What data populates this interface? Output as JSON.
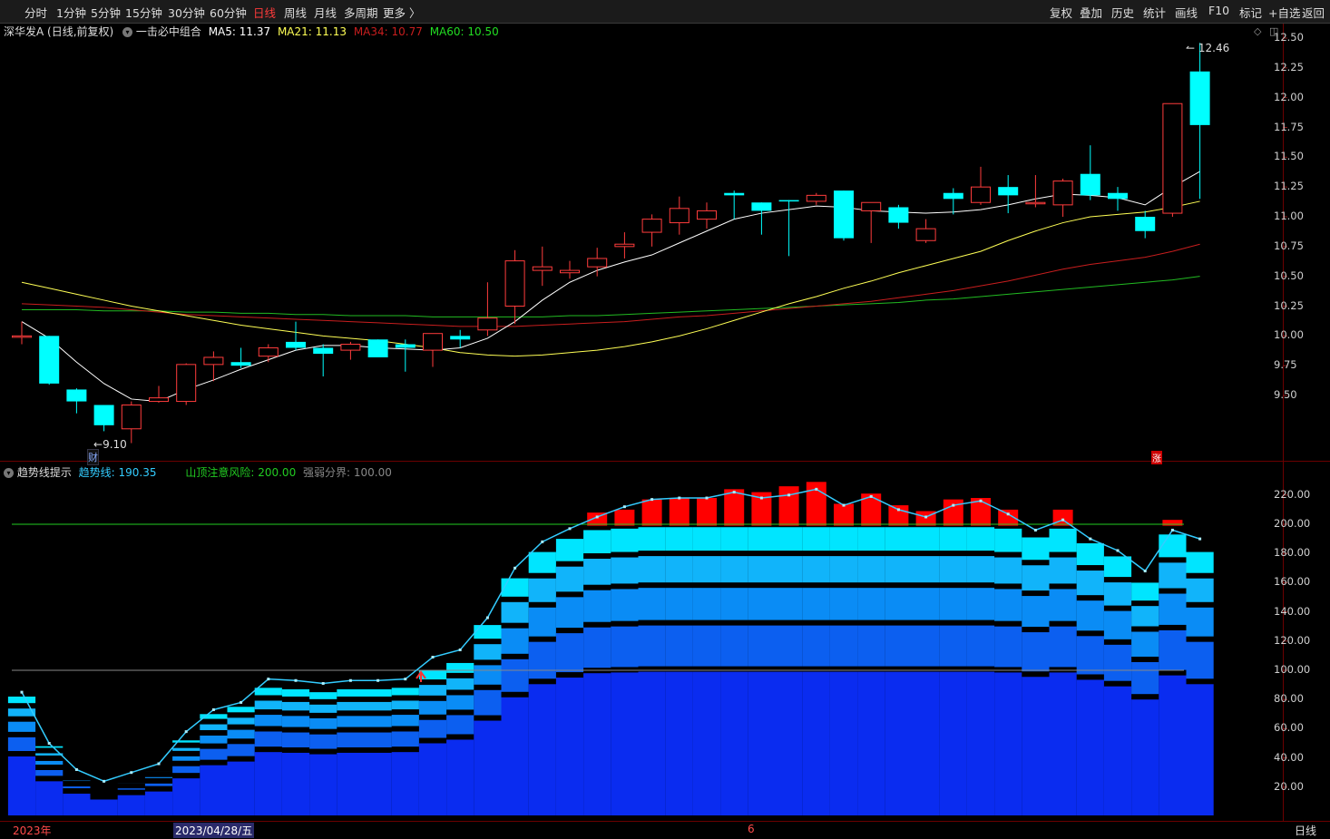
{
  "toolbar": {
    "periods": [
      "分时",
      "1分钟",
      "5分钟",
      "15分钟",
      "30分钟",
      "60分钟",
      "日线",
      "周线",
      "月线",
      "多周期",
      "更多 〉"
    ],
    "active_period": "日线",
    "actions": [
      "复权",
      "叠加",
      "历史",
      "统计",
      "画线",
      "F10",
      "标记",
      "+自选",
      "返回"
    ]
  },
  "main_legend": {
    "stock": "深华发A (日线,前复权)",
    "indicator": "一击必中组合",
    "ma5": "MA5: 11.37",
    "ma21": "MA21: 11.13",
    "ma34": "MA34: 10.77",
    "ma60": "MA60: 10.50"
  },
  "sub_legend": {
    "title": "趋势线提示",
    "trend": "趋势线: 190.35",
    "risk": "山顶注意风险: 200.00",
    "boundary": "强弱分界: 100.00"
  },
  "annotations": {
    "high": "12.46",
    "low": "9.10",
    "cai": "财",
    "zhang": "涨"
  },
  "bottom_axis": {
    "year": "2023年",
    "cursor_date": "2023/04/28/五",
    "month": "6",
    "period": "日线"
  },
  "colors": {
    "up": "#ff3c3c",
    "down": "#00ffff",
    "ma5": "#ffffff",
    "ma21": "#ffff55",
    "ma34": "#c81e1e",
    "ma60": "#22bb22",
    "trend": "#33ccff"
  },
  "chart_data": [
    {
      "type": "candlestick",
      "title": "深华发A (日线,前复权)",
      "ylim": [
        9.2,
        12.6
      ],
      "yticks": [
        9.5,
        9.75,
        10.0,
        10.25,
        10.5,
        10.75,
        11.0,
        11.25,
        11.5,
        11.75,
        12.0,
        12.25,
        12.5
      ],
      "ohlc": [
        [
          10.0,
          10.12,
          9.93,
          10.0
        ],
        [
          10.0,
          10.0,
          9.59,
          9.6
        ],
        [
          9.55,
          9.56,
          9.35,
          9.45
        ],
        [
          9.42,
          9.42,
          9.2,
          9.25
        ],
        [
          9.22,
          9.45,
          9.1,
          9.42
        ],
        [
          9.45,
          9.58,
          9.44,
          9.48
        ],
        [
          9.45,
          9.77,
          9.42,
          9.76
        ],
        [
          9.76,
          9.87,
          9.62,
          9.82
        ],
        [
          9.78,
          9.9,
          9.73,
          9.75
        ],
        [
          9.83,
          9.93,
          9.78,
          9.9
        ],
        [
          9.95,
          10.12,
          9.88,
          9.9
        ],
        [
          9.9,
          9.93,
          9.66,
          9.85
        ],
        [
          9.88,
          9.95,
          9.8,
          9.93
        ],
        [
          9.97,
          9.97,
          9.85,
          9.82
        ],
        [
          9.93,
          9.97,
          9.7,
          9.9
        ],
        [
          9.88,
          10.02,
          9.74,
          10.02
        ],
        [
          10.0,
          10.05,
          9.9,
          9.97
        ],
        [
          10.05,
          10.45,
          10.0,
          10.15
        ],
        [
          10.25,
          10.72,
          10.1,
          10.63
        ],
        [
          10.55,
          10.75,
          10.42,
          10.58
        ],
        [
          10.53,
          10.63,
          10.48,
          10.55
        ],
        [
          10.58,
          10.74,
          10.5,
          10.65
        ],
        [
          10.75,
          10.87,
          10.65,
          10.77
        ],
        [
          10.87,
          11.02,
          10.75,
          10.98
        ],
        [
          10.95,
          11.17,
          10.85,
          11.07
        ],
        [
          10.98,
          11.12,
          10.9,
          11.05
        ],
        [
          11.2,
          11.22,
          10.98,
          11.18
        ],
        [
          11.12,
          11.12,
          10.85,
          11.05
        ],
        [
          11.14,
          11.14,
          10.67,
          11.13
        ],
        [
          11.13,
          11.2,
          11.1,
          11.18
        ],
        [
          11.22,
          11.22,
          10.8,
          10.82
        ],
        [
          11.05,
          11.12,
          10.78,
          11.12
        ],
        [
          11.08,
          11.1,
          10.9,
          10.95
        ],
        [
          10.8,
          10.98,
          10.78,
          10.9
        ],
        [
          11.2,
          11.24,
          11.02,
          11.15
        ],
        [
          11.12,
          11.42,
          11.1,
          11.25
        ],
        [
          11.25,
          11.35,
          11.03,
          11.18
        ],
        [
          11.12,
          11.35,
          11.08,
          11.12
        ],
        [
          11.1,
          11.32,
          11.0,
          11.3
        ],
        [
          11.36,
          11.6,
          11.14,
          11.18
        ],
        [
          11.2,
          11.25,
          11.05,
          11.15
        ],
        [
          11.0,
          11.05,
          10.82,
          10.88
        ],
        [
          11.03,
          11.95,
          11.0,
          11.95
        ],
        [
          12.22,
          12.46,
          11.15,
          11.77
        ]
      ],
      "ma5": [
        10.12,
        9.98,
        9.78,
        9.6,
        9.47,
        9.45,
        9.55,
        9.63,
        9.72,
        9.8,
        9.88,
        9.92,
        9.92,
        9.9,
        9.89,
        9.88,
        9.9,
        9.98,
        10.12,
        10.3,
        10.45,
        10.55,
        10.62,
        10.68,
        10.78,
        10.88,
        10.98,
        11.03,
        11.06,
        11.09,
        11.08,
        11.05,
        11.04,
        11.03,
        11.04,
        11.06,
        11.1,
        11.15,
        11.19,
        11.18,
        11.16,
        11.1,
        11.25,
        11.38
      ],
      "ma21": [
        10.45,
        10.4,
        10.35,
        10.3,
        10.25,
        10.21,
        10.17,
        10.13,
        10.09,
        10.06,
        10.03,
        10.0,
        9.98,
        9.96,
        9.93,
        9.9,
        9.86,
        9.84,
        9.83,
        9.84,
        9.86,
        9.88,
        9.91,
        9.95,
        10.0,
        10.06,
        10.13,
        10.2,
        10.27,
        10.33,
        10.4,
        10.46,
        10.53,
        10.59,
        10.65,
        10.71,
        10.8,
        10.88,
        10.95,
        11.0,
        11.02,
        11.04,
        11.08,
        11.13
      ],
      "ma34": [
        10.27,
        10.26,
        10.25,
        10.24,
        10.22,
        10.2,
        10.18,
        10.17,
        10.16,
        10.15,
        10.14,
        10.13,
        10.12,
        10.11,
        10.1,
        10.09,
        10.08,
        10.08,
        10.08,
        10.09,
        10.1,
        10.11,
        10.12,
        10.14,
        10.16,
        10.17,
        10.19,
        10.21,
        10.23,
        10.25,
        10.27,
        10.29,
        10.32,
        10.35,
        10.38,
        10.42,
        10.46,
        10.51,
        10.56,
        10.6,
        10.63,
        10.66,
        10.71,
        10.77
      ],
      "ma60": [
        10.22,
        10.22,
        10.22,
        10.21,
        10.21,
        10.21,
        10.2,
        10.2,
        10.19,
        10.19,
        10.18,
        10.18,
        10.17,
        10.17,
        10.17,
        10.16,
        10.16,
        10.16,
        10.16,
        10.16,
        10.17,
        10.17,
        10.18,
        10.19,
        10.2,
        10.21,
        10.22,
        10.23,
        10.24,
        10.25,
        10.26,
        10.27,
        10.28,
        10.3,
        10.31,
        10.33,
        10.35,
        10.37,
        10.39,
        10.41,
        10.43,
        10.45,
        10.47,
        10.5
      ]
    },
    {
      "type": "bar",
      "title": "趋势线提示",
      "ylim": [
        0,
        230
      ],
      "yticks": [
        20,
        40,
        60,
        80,
        100,
        120,
        140,
        160,
        180,
        200,
        220
      ],
      "reference_lines": [
        100,
        200
      ],
      "trend": [
        85,
        50,
        32,
        24,
        30,
        36,
        58,
        73,
        78,
        94,
        93,
        91,
        93,
        93,
        94,
        109,
        114,
        136,
        170,
        188,
        197,
        205,
        212,
        217,
        218,
        218,
        222,
        218,
        220,
        224,
        213,
        219,
        210,
        205,
        213,
        216,
        207,
        196,
        203,
        190,
        182,
        168,
        196,
        190
      ],
      "red_bars": [
        [
          0,
          0
        ],
        [
          0,
          0
        ],
        [
          0,
          0
        ],
        [
          0,
          0
        ],
        [
          0,
          0
        ],
        [
          0,
          0
        ],
        [
          0,
          0
        ],
        [
          0,
          0
        ],
        [
          0,
          0
        ],
        [
          0,
          0
        ],
        [
          0,
          0
        ],
        [
          0,
          0
        ],
        [
          0,
          0
        ],
        [
          0,
          0
        ],
        [
          0,
          0
        ],
        [
          0,
          0
        ],
        [
          0,
          0
        ],
        [
          0,
          0
        ],
        [
          0,
          0
        ],
        [
          0,
          0
        ],
        [
          0,
          0
        ],
        [
          199,
          208
        ],
        [
          199,
          210
        ],
        [
          199,
          217
        ],
        [
          199,
          218
        ],
        [
          199,
          218
        ],
        [
          199,
          224
        ],
        [
          199,
          222
        ],
        [
          199,
          226
        ],
        [
          199,
          229
        ],
        [
          199,
          214
        ],
        [
          199,
          221
        ],
        [
          199,
          213
        ],
        [
          199,
          209
        ],
        [
          199,
          217
        ],
        [
          199,
          218
        ],
        [
          199,
          210
        ],
        [
          0,
          0
        ],
        [
          199,
          210
        ],
        [
          0,
          0
        ],
        [
          0,
          0
        ],
        [
          0,
          0
        ],
        [
          199,
          203
        ],
        [
          0,
          0
        ]
      ],
      "layer_top": [
        82,
        48,
        31,
        23,
        29,
        34,
        52,
        70,
        75,
        88,
        87,
        85,
        87,
        87,
        88,
        100,
        105,
        131,
        163,
        181,
        190,
        196,
        197,
        198,
        198,
        198,
        198,
        198,
        198,
        198,
        198,
        198,
        198,
        198,
        198,
        198,
        197,
        191,
        197,
        187,
        178,
        160,
        193,
        181
      ]
    }
  ]
}
